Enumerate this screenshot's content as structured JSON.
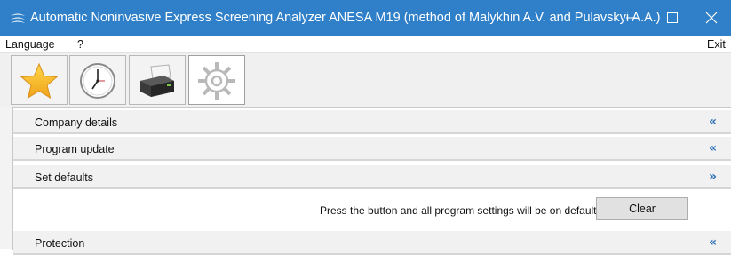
{
  "window": {
    "title": "Automatic Noninvasive Express Screening Analyzer ANESA M19 (method of Malykhin A.V. and Pulavskyi A.A.)",
    "accent_color": "#2f80c9"
  },
  "menu": {
    "language": "Language",
    "help": "?",
    "exit": "Exit"
  },
  "toolbar": {
    "buttons": [
      {
        "icon": "star-icon",
        "active": false
      },
      {
        "icon": "clock-icon",
        "active": false
      },
      {
        "icon": "printer-icon",
        "active": false
      },
      {
        "icon": "gear-icon",
        "active": true
      }
    ]
  },
  "sections": {
    "company": {
      "label": "Company details",
      "chevron": "«"
    },
    "update": {
      "label": "Program update",
      "chevron": "«"
    },
    "defaults": {
      "label": "Set defaults",
      "chevron": "»",
      "message": "Press the button and all program settings will be on default",
      "button_label": "Clear"
    },
    "protection": {
      "label": "Protection",
      "chevron": "«"
    }
  }
}
